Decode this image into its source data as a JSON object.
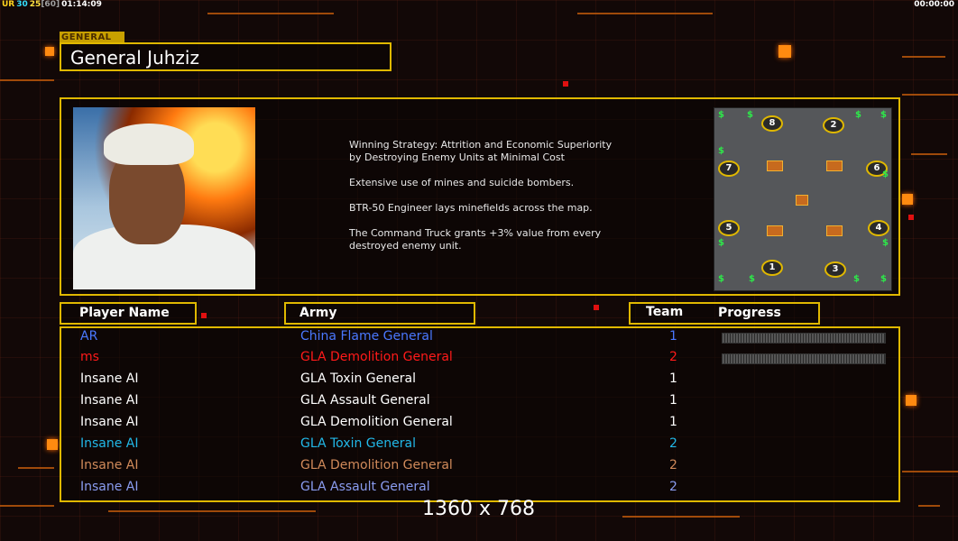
{
  "statusbar": {
    "items": [
      {
        "text": "UR",
        "color": "#ffd21e"
      },
      {
        "text": "30",
        "color": "#35e0ff"
      },
      {
        "text": "25",
        "color": "#ffe040"
      },
      {
        "text": "[60]",
        "color": "#a0a0a0"
      },
      {
        "text": "01:14:09",
        "color": "#ffffff"
      }
    ],
    "clock_right": "00:00:00"
  },
  "general": {
    "tag": "GENERAL",
    "name": "General Juhziz",
    "description": [
      "Winning Strategy: Attrition and Economic Superiority\n by Destroying Enemy Units at Minimal Cost",
      "Extensive use of mines and suicide bombers.",
      "BTR-50 Engineer lays minefields across the map.",
      "The Command Truck grants +3% value from every\n destroyed enemy unit."
    ]
  },
  "minimap": {
    "start_positions": [
      "8",
      "2",
      "7",
      "6",
      "5",
      "4",
      "1",
      "3"
    ],
    "resource_icon": "dollar-icon"
  },
  "headers": {
    "player_name": "Player Name",
    "army": "Army",
    "team": "Team",
    "progress": "Progress"
  },
  "players": [
    {
      "name": "AR",
      "army": "China Flame General",
      "team": "1",
      "color": "#4a78ff",
      "progress": 0
    },
    {
      "name": "ms",
      "army": "GLA Demolition General",
      "team": "2",
      "color": "#ff1a1a",
      "progress": 0
    },
    {
      "name": "Insane AI",
      "army": "GLA Toxin General",
      "team": "1",
      "color": "#ffffff"
    },
    {
      "name": "Insane AI",
      "army": "GLA Assault General",
      "team": "1",
      "color": "#ffffff"
    },
    {
      "name": "Insane AI",
      "army": "GLA Demolition General",
      "team": "1",
      "color": "#ffffff"
    },
    {
      "name": "Insane AI",
      "army": "GLA Toxin General",
      "team": "2",
      "color": "#22b8e8"
    },
    {
      "name": "Insane AI",
      "army": "GLA Demolition General",
      "team": "2",
      "color": "#d08a5a"
    },
    {
      "name": "Insane AI",
      "army": "GLA Assault General",
      "team": "2",
      "color": "#8a9cf0"
    }
  ],
  "resolution": "1360 x 768"
}
